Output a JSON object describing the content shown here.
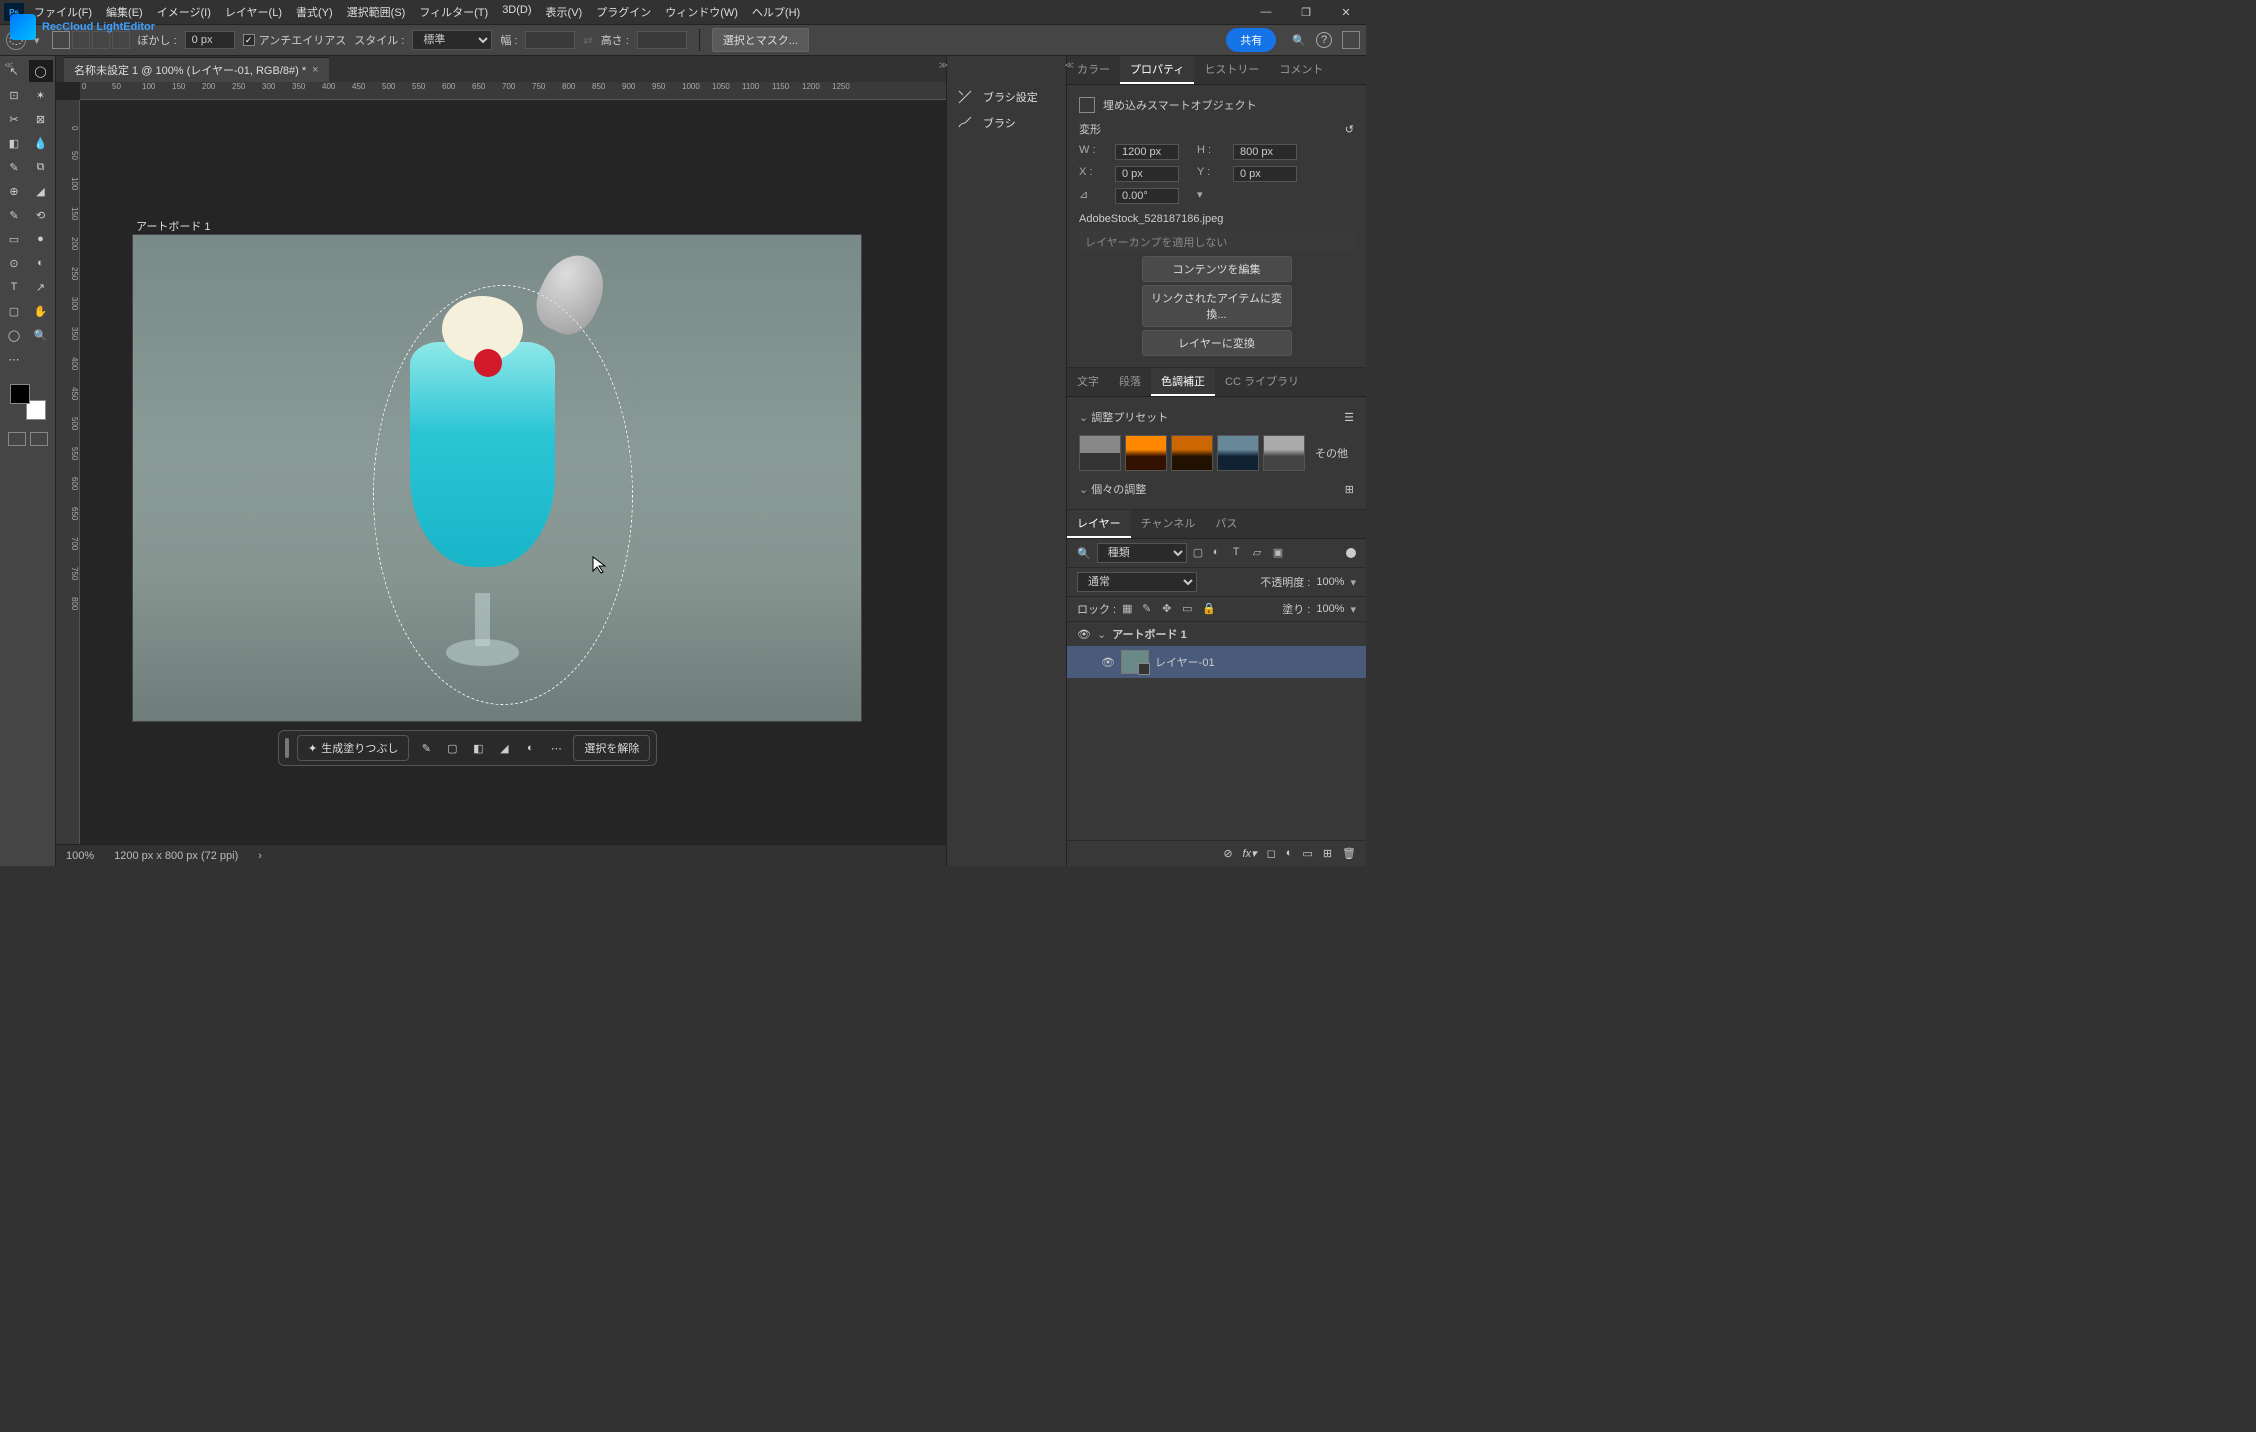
{
  "watermark": "RecCloud LightEditor",
  "menubar": [
    "ファイル(F)",
    "編集(E)",
    "イメージ(I)",
    "レイヤー(L)",
    "書式(Y)",
    "選択範囲(S)",
    "フィルター(T)",
    "3D(D)",
    "表示(V)",
    "プラグイン",
    "ウィンドウ(W)",
    "ヘルプ(H)"
  ],
  "optionsbar": {
    "feather_label": "ぼかし :",
    "feather_value": "0 px",
    "antialias": "アンチエイリアス",
    "style_label": "スタイル :",
    "style_value": "標準",
    "width_label": "幅 :",
    "height_label": "高さ :",
    "selmask": "選択とマスク...",
    "share": "共有"
  },
  "doc_tab": "名称未設定 1 @ 100% (レイヤー-01, RGB/8#) *",
  "ruler_h": [
    "0",
    "50",
    "100",
    "150",
    "200",
    "250",
    "300",
    "350",
    "400",
    "450",
    "500",
    "550",
    "600",
    "650",
    "700",
    "750",
    "800",
    "850",
    "900",
    "950",
    "1000",
    "1050",
    "1100",
    "1150",
    "1200",
    "1250"
  ],
  "ruler_v": [
    "0",
    "50",
    "100",
    "150",
    "200",
    "250",
    "300",
    "350",
    "400",
    "450",
    "500",
    "550",
    "600",
    "650",
    "700",
    "750",
    "800"
  ],
  "artboard_label": "アートボード 1",
  "context_toolbar": {
    "genfill": "生成塗りつぶし",
    "deselect": "選択を解除"
  },
  "statusbar": {
    "zoom": "100%",
    "docinfo": "1200 px x 800 px (72 ppi)"
  },
  "midpanel": {
    "brush_settings": "ブラシ設定",
    "brush": "ブラシ"
  },
  "rightpanel": {
    "tabs_top": [
      "カラー",
      "プロパティ",
      "ヒストリー",
      "コメント"
    ],
    "properties": {
      "title": "埋め込みスマートオブジェクト",
      "transform": "変形",
      "W_label": "W :",
      "W": "1200 px",
      "H_label": "H :",
      "H": "800 px",
      "X_label": "X :",
      "X": "0 px",
      "Y_label": "Y :",
      "Y": "0 px",
      "angle": "0.00°",
      "filename": "AdobeStock_528187186.jpeg",
      "layercomp": "レイヤーカンプを適用しない",
      "btn_edit": "コンテンツを編集",
      "btn_convert_link": "リンクされたアイテムに変換...",
      "btn_convert_layer": "レイヤーに変換"
    },
    "tabs_mid": [
      "文字",
      "段落",
      "色調補正",
      "CC ライブラリ"
    ],
    "adjust_presets": "調整プリセット",
    "preset_more": "その他",
    "individual_adjust": "個々の調整",
    "tabs_layers": [
      "レイヤー",
      "チャンネル",
      "パス"
    ],
    "layer_kind": "種類",
    "blend_mode": "通常",
    "opacity_label": "不透明度 :",
    "opacity": "100%",
    "lock_label": "ロック :",
    "fill_label": "塗り :",
    "fill": "100%",
    "layers": [
      {
        "name": "アートボード 1",
        "type": "group"
      },
      {
        "name": "レイヤー-01",
        "type": "smart",
        "selected": true
      }
    ]
  }
}
